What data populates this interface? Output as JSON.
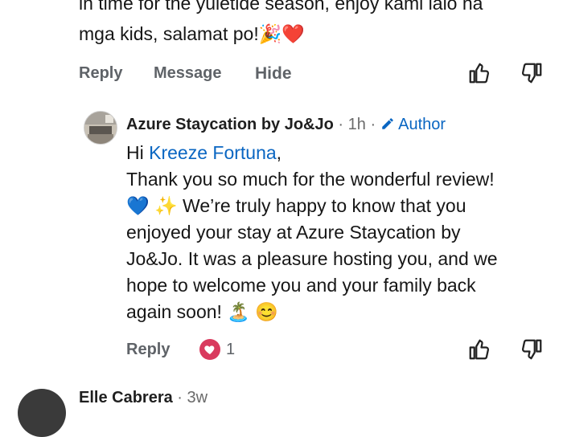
{
  "parent_comment": {
    "text_line1": "in time for the yuletide season, enjoy kami lalo na",
    "text_line2": "mga kids, salamat po!",
    "emoji": "🎉❤️",
    "actions": {
      "reply": "Reply",
      "message": "Message",
      "hide": "Hide"
    }
  },
  "reply": {
    "author": "Azure Staycation by Jo&Jo",
    "time": "1h",
    "author_badge": "Author",
    "greeting": "Hi",
    "mention": "Kreeze Fortuna",
    "greeting_suffix": ",",
    "lines": [
      "Thank you so much for the wonderful review!",
      "💙 ✨ We’re truly happy to know that you",
      "enjoyed your stay at Azure Staycation by",
      "Jo&Jo. It was a pleasure hosting you, and we",
      "hope to welcome you and your family back",
      "again soon! 🏝️ 😊"
    ],
    "actions": {
      "reply": "Reply",
      "reaction_count": "1"
    }
  },
  "next_comment": {
    "author": "Elle Cabrera",
    "time": "3w"
  },
  "colors": {
    "link": "#0a66c2",
    "heart_badge": "#d93a5e",
    "muted": "#5f6368"
  },
  "icons": [
    "thumbs-up-icon",
    "thumbs-down-icon",
    "pencil-icon",
    "heart-reaction-icon"
  ]
}
